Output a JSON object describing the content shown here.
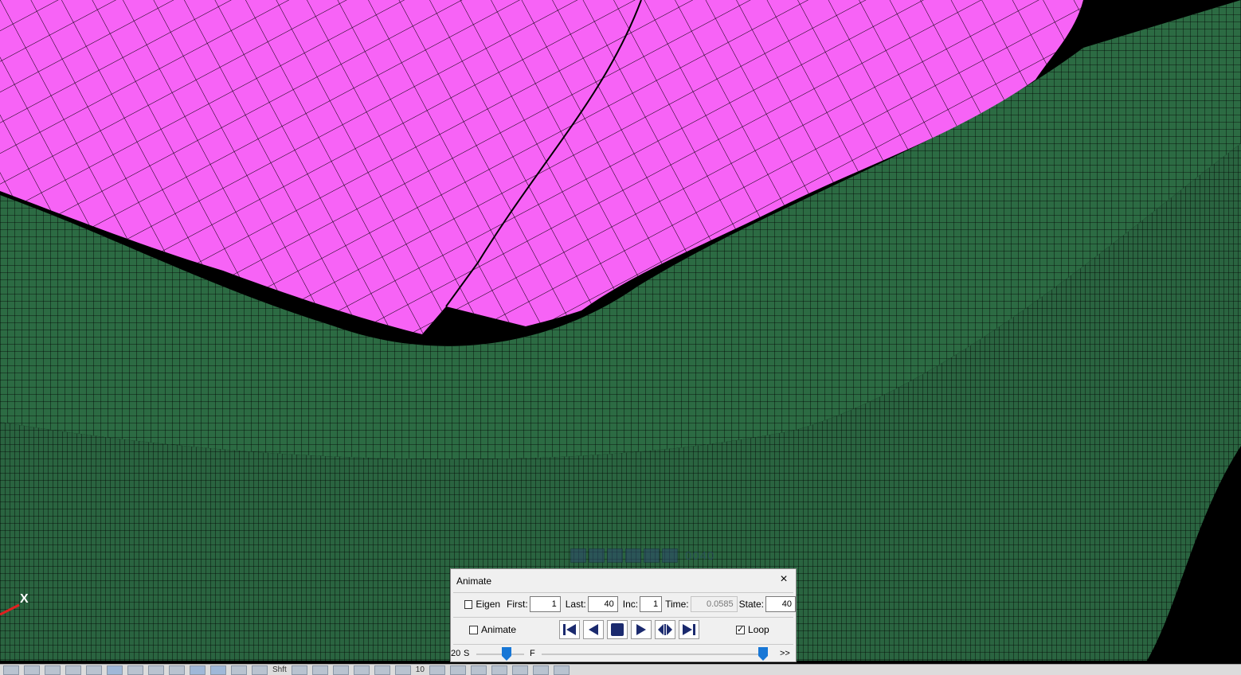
{
  "viewport": {
    "colors": {
      "top_part": "#f763f6",
      "bottom_part": "#2c6b43",
      "background": "#000000",
      "mesh_line": "#000000"
    },
    "ghost_label": "0040",
    "axis_label": "X"
  },
  "animate_dialog": {
    "title": "Animate",
    "close_icon": "×",
    "eigen_label": "Eigen",
    "eigen_checked": false,
    "first_label": "First:",
    "first_value": "1",
    "last_label": "Last:",
    "last_value": "40",
    "inc_label": "Inc:",
    "inc_value": "1",
    "time_label": "Time:",
    "time_value": "0.0585",
    "state_label": "State:",
    "state_value": "40",
    "animate_label": "Animate",
    "animate_checked": false,
    "loop_label": "Loop",
    "loop_checked": true,
    "speed_left": "20",
    "speed_s": "S",
    "speed_f": "F",
    "speed_more": ">>",
    "playback_icons": [
      "first-frame-icon",
      "step-back-icon",
      "stop-icon",
      "play-icon",
      "bounce-icon",
      "last-frame-icon"
    ]
  },
  "toolbar": {
    "shift_label": "Shft",
    "count_label": "10"
  }
}
